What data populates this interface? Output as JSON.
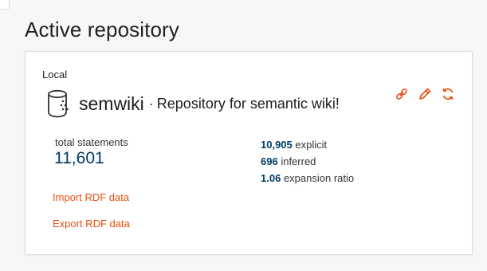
{
  "section": {
    "title": "Active repository"
  },
  "repository": {
    "location": "Local",
    "name": "semwiki",
    "separator": "·",
    "description": "Repository for semantic wiki!",
    "icon": "database-icon"
  },
  "actions": [
    {
      "name": "copy-link",
      "icon": "link-icon"
    },
    {
      "name": "edit",
      "icon": "pencil-icon"
    },
    {
      "name": "restart",
      "icon": "refresh-icon"
    }
  ],
  "stats": {
    "total_label": "total statements",
    "total_value": "11,601",
    "explicit_value": "10,905",
    "explicit_label": "explicit",
    "inferred_value": "696",
    "inferred_label": "inferred",
    "expansion_value": "1.06",
    "expansion_label": "expansion ratio"
  },
  "links": {
    "import": "Import RDF data",
    "export": "Export RDF data"
  },
  "colors": {
    "accent": "#e84e0f",
    "value": "#003a63"
  }
}
